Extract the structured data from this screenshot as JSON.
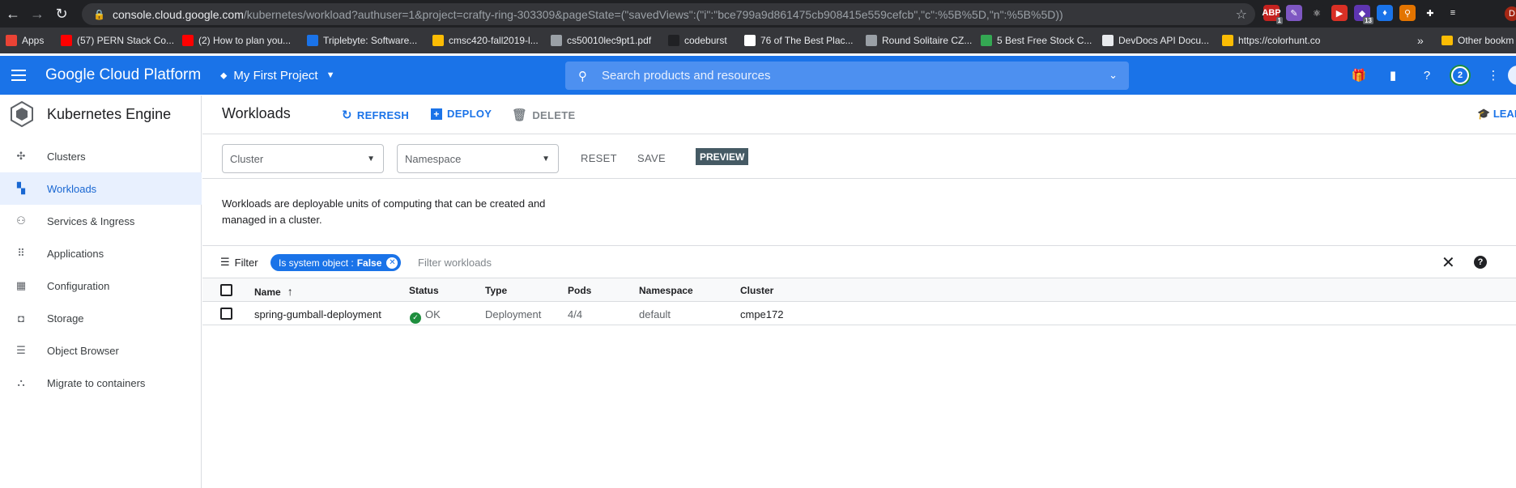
{
  "browser": {
    "url_host": "console.cloud.google.com",
    "url_rest": "/kubernetes/workload?authuser=1&project=crafty-ring-303309&pageState=(\"savedViews\":(\"i\":\"bce799a9d861475cb908415e559cefcb\",\"c\":%5B%5D,\"n\":%5B%5D))",
    "profile_initial": "D",
    "extensions": [
      {
        "name": "adblock-icon",
        "color": "#c5221f",
        "text": "ABP",
        "badge": "1"
      },
      {
        "name": "feather-icon",
        "color": "#7e57c2",
        "text": "✎",
        "badge": ""
      },
      {
        "name": "react-icon",
        "color": "#202124",
        "text": "⚛",
        "badge": ""
      },
      {
        "name": "youtube-icon",
        "color": "#d93025",
        "text": "▶",
        "badge": ""
      },
      {
        "name": "purple-ext-icon",
        "color": "#5e35b1",
        "text": "◆",
        "badge": "13"
      },
      {
        "name": "gem-icon",
        "color": "#1a73e8",
        "text": "♦",
        "badge": ""
      },
      {
        "name": "pin-icon",
        "color": "#e37400",
        "text": "⚲",
        "badge": ""
      },
      {
        "name": "puzzle-icon",
        "color": "#202124",
        "text": "✚",
        "badge": ""
      },
      {
        "name": "media-icon",
        "color": "#202124",
        "text": "≡",
        "badge": ""
      }
    ]
  },
  "bookmarks": {
    "items": [
      {
        "label": "Apps",
        "color": "#ea4335"
      },
      {
        "label": "(57) PERN Stack Co...",
        "color": "#ff0000"
      },
      {
        "label": "(2) How to plan you...",
        "color": "#ff0000"
      },
      {
        "label": "Triplebyte: Software...",
        "color": "#1a73e8"
      },
      {
        "label": "cmsc420-fall2019-l...",
        "color": "#fbbc04"
      },
      {
        "label": "cs50010lec9pt1.pdf",
        "color": "#9aa0a6"
      },
      {
        "label": "codeburst",
        "color": "#202124"
      },
      {
        "label": "76 of The Best Plac...",
        "color": "#ffffff"
      },
      {
        "label": "Round Solitaire CZ...",
        "color": "#9aa0a6"
      },
      {
        "label": "5 Best Free Stock C...",
        "color": "#34a853"
      },
      {
        "label": "DevDocs API Docu...",
        "color": "#e8eaed"
      },
      {
        "label": "https://colorhunt.co",
        "color": "#fbbc04"
      }
    ],
    "more": "»",
    "other": "Other bookm"
  },
  "header": {
    "logo": "Google Cloud Platform",
    "project": "My First Project",
    "search_placeholder": "Search products and resources",
    "notifications": "2"
  },
  "sidebar": {
    "title": "Kubernetes Engine",
    "items": [
      {
        "label": "Clusters",
        "icon": "clusters-icon",
        "glyph": "✣"
      },
      {
        "label": "Workloads",
        "icon": "workloads-icon",
        "glyph": "▚"
      },
      {
        "label": "Services & Ingress",
        "icon": "services-icon",
        "glyph": "⚇"
      },
      {
        "label": "Applications",
        "icon": "applications-icon",
        "glyph": "⠿"
      },
      {
        "label": "Configuration",
        "icon": "configuration-icon",
        "glyph": "▦"
      },
      {
        "label": "Storage",
        "icon": "storage-icon",
        "glyph": "◘"
      },
      {
        "label": "Object Browser",
        "icon": "object-browser-icon",
        "glyph": "☰"
      },
      {
        "label": "Migrate to containers",
        "icon": "migrate-icon",
        "glyph": "⛬"
      }
    ]
  },
  "toolbar": {
    "title": "Workloads",
    "refresh": "REFRESH",
    "deploy": "DEPLOY",
    "delete": "DELETE",
    "learn": "LEAR"
  },
  "filters": {
    "cluster_placeholder": "Cluster",
    "namespace_placeholder": "Namespace",
    "reset": "RESET",
    "save": "SAVE",
    "preview": "PREVIEW"
  },
  "description": "Workloads are deployable units of computing that can be created and managed in a cluster.",
  "filter_bar": {
    "label": "Filter",
    "chip_key": "Is system object :",
    "chip_value": "False",
    "placeholder": "Filter workloads"
  },
  "table": {
    "columns": [
      "Name",
      "Status",
      "Type",
      "Pods",
      "Namespace",
      "Cluster"
    ],
    "rows": [
      {
        "name": "spring-gumball-deployment",
        "status": "OK",
        "type": "Deployment",
        "pods": "4/4",
        "namespace": "default",
        "cluster": "cmpe172"
      }
    ]
  }
}
